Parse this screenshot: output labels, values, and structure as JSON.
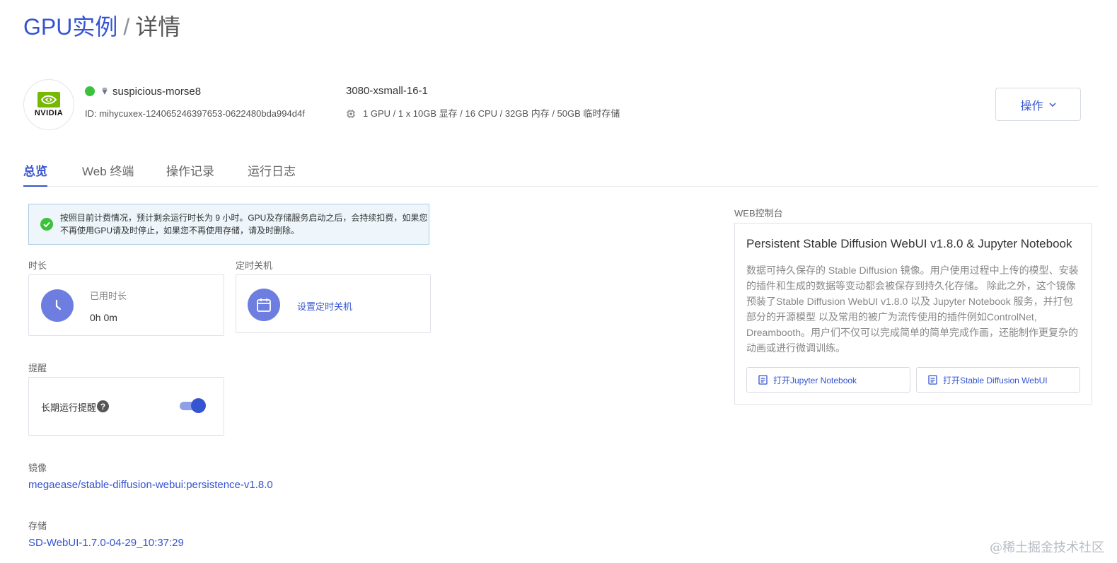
{
  "breadcrumb": {
    "parent": "GPU实例",
    "separator": "/",
    "current": "详情"
  },
  "instance": {
    "logo_text": "NVIDIA",
    "name": "suspicious-morse8",
    "id": "ID: mihycuxex-124065246397653-0622480bda994d4f",
    "spec": "3080-xsmall-16-1",
    "resources": "1 GPU / 1 x 10GB 显存 / 16 CPU / 32GB 内存 / 50GB 临时存储",
    "status_color": "#3cc13b"
  },
  "header": {
    "action_label": "操作"
  },
  "tabs": [
    {
      "label": "总览",
      "active": true
    },
    {
      "label": "Web 终端",
      "active": false
    },
    {
      "label": "操作记录",
      "active": false
    },
    {
      "label": "运行日志",
      "active": false
    }
  ],
  "notice": {
    "text": "按照目前计费情况，预计剩余运行时长为 9 小时。GPU及存储服务启动之后，会持续扣费，如果您不再使用GPU请及时停止，如果您不再使用存储，请及时删除。"
  },
  "duration": {
    "section": "时长",
    "label": "已用时长",
    "value": "0h 0m"
  },
  "schedule": {
    "section": "定时关机",
    "link": "设置定时关机"
  },
  "reminder": {
    "section": "提醒",
    "label": "长期运行提醒",
    "enabled": true
  },
  "image": {
    "section": "镜像",
    "value": "megaease/stable-diffusion-webui:persistence-v1.8.0"
  },
  "storage": {
    "section": "存储",
    "value": "SD-WebUI-1.7.0-04-29_10:37:29"
  },
  "web_console": {
    "section": "WEB控制台",
    "title": "Persistent Stable Diffusion WebUI v1.8.0 & Jupyter Notebook",
    "description": "数据可持久保存的 Stable Diffusion 镜像。用户使用过程中上传的模型、安装的插件和生成的数据等变动都会被保存到持久化存储。 除此之外，这个镜像预装了Stable Diffusion WebUI v1.8.0 以及 Jupyter Notebook 服务，并打包部分的开源模型 以及常用的被广为流传使用的插件例如ControlNet, Dreambooth。用户们不仅可以完成简单的简单完成作画，还能制作更复杂的动画或进行微调训练。",
    "buttons": [
      {
        "label": "打开Jupyter Notebook"
      },
      {
        "label": "打开Stable Diffusion WebUI"
      }
    ]
  },
  "watermark": "@稀土掘金技术社区",
  "colors": {
    "accent": "#3554d1",
    "icon_bg": "#6d7ee0",
    "success": "#3cc13b"
  }
}
